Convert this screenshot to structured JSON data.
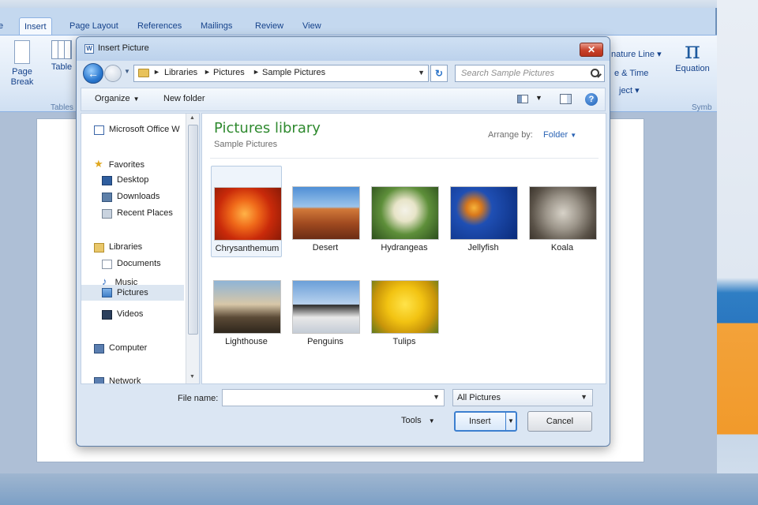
{
  "word": {
    "tabs": [
      "Insert",
      "Page Layout",
      "References",
      "Mailings",
      "Review",
      "View"
    ],
    "active_tab": "Insert",
    "ribbon": {
      "page_break_label": "Page\nBreak",
      "table_label": "Table",
      "tables_group": "Tables",
      "signature_line": "nature Line",
      "date_time": "e & Time",
      "object": "ject",
      "equation_label": "Equation",
      "symbols_group": "Symb",
      "pi_symbol": "π"
    }
  },
  "dialog": {
    "title": "Insert Picture",
    "close_glyph": "✕",
    "address": {
      "crumbs": [
        "Libraries",
        "Pictures",
        "Sample Pictures"
      ]
    },
    "search_placeholder": "Search Sample Pictures",
    "toolbar": {
      "organize": "Organize",
      "new_folder": "New folder"
    },
    "nav": {
      "items": [
        {
          "label": "Microsoft Office W",
          "icon": "word-icon"
        },
        {
          "label": "Favorites",
          "icon": "star-icon"
        },
        {
          "label": "Desktop",
          "icon": "desktop-icon"
        },
        {
          "label": "Downloads",
          "icon": "downloads-icon"
        },
        {
          "label": "Recent Places",
          "icon": "recent-places-icon"
        },
        {
          "label": "Libraries",
          "icon": "libraries-icon"
        },
        {
          "label": "Documents",
          "icon": "documents-icon"
        },
        {
          "label": "Music",
          "icon": "music-icon"
        },
        {
          "label": "Pictures",
          "icon": "pictures-icon"
        },
        {
          "label": "Videos",
          "icon": "videos-icon"
        },
        {
          "label": "Computer",
          "icon": "computer-icon"
        },
        {
          "label": "Network",
          "icon": "network-icon"
        }
      ],
      "selected": "Pictures"
    },
    "library": {
      "title": "Pictures library",
      "subtitle": "Sample Pictures",
      "arrange_label": "Arrange by:",
      "arrange_value": "Folder"
    },
    "pictures": [
      "Chrysanthemum",
      "Desert",
      "Hydrangeas",
      "Jellyfish",
      "Koala",
      "Lighthouse",
      "Penguins",
      "Tulips"
    ],
    "selected_picture": "Chrysanthemum",
    "file_name_label": "File name:",
    "file_name_value": "",
    "filter": "All Pictures",
    "tools": "Tools",
    "insert": "Insert",
    "cancel": "Cancel"
  }
}
